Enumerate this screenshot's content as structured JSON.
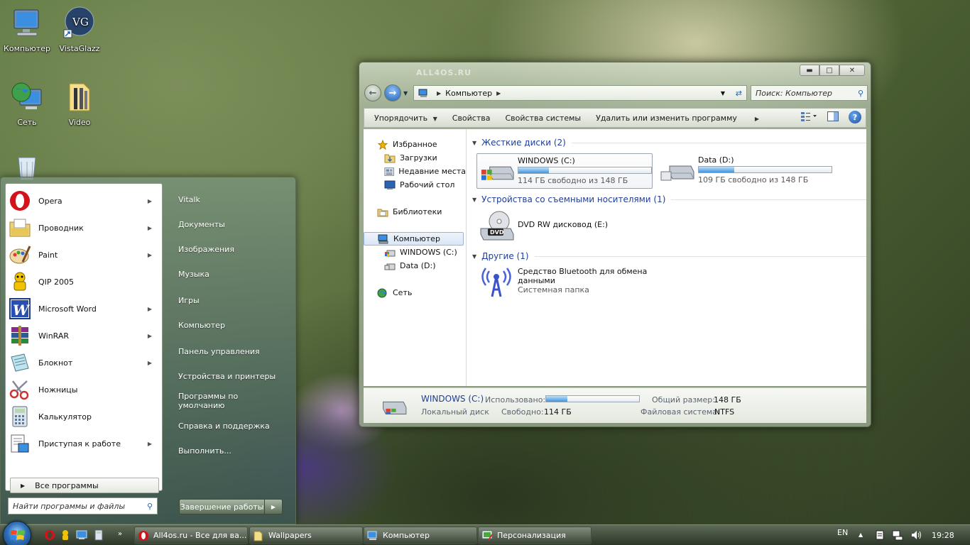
{
  "desktop": {
    "icons": [
      {
        "label": "Компьютер"
      },
      {
        "label": "VistaGlazz"
      },
      {
        "label": "Сеть"
      },
      {
        "label": "Video"
      }
    ]
  },
  "explorer": {
    "watermark": "ALL4OS.RU",
    "address": {
      "location": "Компьютер"
    },
    "search": {
      "placeholder": "Поиск: Компьютер"
    },
    "toolbar": {
      "organize": "Упорядочить",
      "properties": "Свойства",
      "system_properties": "Свойства системы",
      "uninstall": "Удалить или изменить программу"
    },
    "nav": {
      "favorites": "Избранное",
      "downloads": "Загрузки",
      "recent": "Недавние места",
      "desktop": "Рабочий стол",
      "libraries": "Библиотеки",
      "computer": "Компьютер",
      "drive_c": "WINDOWS (C:)",
      "drive_d": "Data (D:)",
      "network": "Сеть"
    },
    "groups": {
      "hard_disks": "Жесткие диски (2)",
      "removable": "Устройства со съемными носителями (1)",
      "other": "Другие (1)"
    },
    "drives": [
      {
        "name": "WINDOWS (C:)",
        "free_text": "114 ГБ свободно из 148 ГБ",
        "used_fraction": 0.23
      },
      {
        "name": "Data (D:)",
        "free_text": "109 ГБ свободно из 148 ГБ",
        "used_fraction": 0.27
      }
    ],
    "dvd": {
      "name": "DVD RW дисковод (E:)",
      "badge": "DVD"
    },
    "bluetooth": {
      "name": "Средство Bluetooth для обмена данными",
      "type": "Системная папка"
    },
    "details": {
      "name": "WINDOWS (C:)",
      "kind": "Локальный диск",
      "used_label": "Использовано:",
      "free_label": "Свободно:",
      "free_value": "114 ГБ",
      "total_label": "Общий размер:",
      "total_value": "148 ГБ",
      "fs_label": "Файловая система:",
      "fs_value": "NTFS",
      "used_fraction": 0.23
    }
  },
  "start_menu": {
    "programs": [
      {
        "label": "Opera",
        "has_arrow": true
      },
      {
        "label": "Проводник",
        "has_arrow": true
      },
      {
        "label": "Paint",
        "has_arrow": true
      },
      {
        "label": "QIP 2005",
        "has_arrow": false
      },
      {
        "label": "Microsoft Word",
        "has_arrow": true
      },
      {
        "label": "WinRAR",
        "has_arrow": true
      },
      {
        "label": "Блокнот",
        "has_arrow": true
      },
      {
        "label": "Ножницы",
        "has_arrow": false
      },
      {
        "label": "Калькулятор",
        "has_arrow": false
      },
      {
        "label": "Приступая к работе",
        "has_arrow": true
      }
    ],
    "all_programs": "Все программы",
    "search_placeholder": "Найти программы и файлы",
    "right": [
      "Vitalk",
      "Документы",
      "Изображения",
      "Музыка",
      "Игры",
      "Компьютер",
      "Панель управления",
      "Устройства и принтеры",
      "Программы по умолчанию",
      "Справка и поддержка",
      "Выполнить..."
    ],
    "shutdown": "Завершение работы"
  },
  "taskbar": {
    "tasks": [
      {
        "label": "All4os.ru - Все для ва..."
      },
      {
        "label": "Wallpapers"
      },
      {
        "label": "Компьютер"
      },
      {
        "label": "Персонализация"
      }
    ],
    "lang": "EN",
    "time": "19:28"
  },
  "colors": {
    "accent": "#1e3f98",
    "bar_fill": "#3f95de"
  }
}
